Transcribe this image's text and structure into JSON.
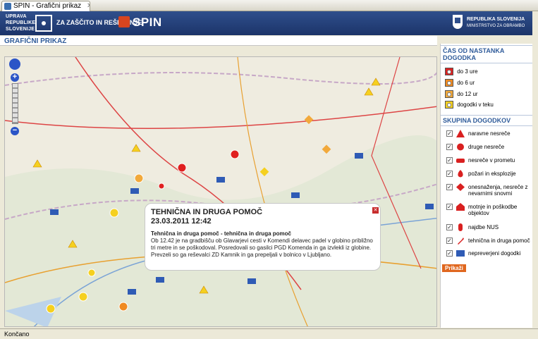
{
  "tab": {
    "title": "SPIN - Grafični prikaz"
  },
  "header": {
    "logo_lines": [
      "UPRAVA",
      "REPUBLIKE",
      "SLOVENIJE"
    ],
    "subtitle": "ZA ZAŠČITO IN REŠEVANJE",
    "app_name": "SPIN",
    "ministry_line1": "REPUBLIKA SLOVENIJA",
    "ministry_line2": "MINISTRSTVO ZA OBRAMBO"
  },
  "page_title": "GRAFIČNI PRIKAZ",
  "popup": {
    "title": "TEHNIČNA IN DRUGA POMOČ",
    "date": "23.03.2011 12:42",
    "subtitle": "Tehnična in druga pomoč - tehnična in druga pomoč",
    "body": "Ob 12.42 je na gradbišču ob Glavarjevi cesti v Komendi delavec padel v globino približno tri metre in se poškodoval. Posredovali so gasilci PGD Komenda in ga izvlekli iz globine. Prevzeli so ga reševalci ZD Kamnik in ga prepeljali v bolnico v Ljubljano."
  },
  "sidebar": {
    "time_heading": "ČAS OD NASTANKA DOGODKA",
    "time_items": [
      {
        "label": "do 3 ure",
        "color": "#e02020"
      },
      {
        "label": "do 6 ur",
        "color": "#f08a20"
      },
      {
        "label": "do 12 ur",
        "color": "#f2a93b"
      },
      {
        "label": "dogodki v teku",
        "color": "#f5d020"
      }
    ],
    "group_heading": "SKUPINA DOGODKOV",
    "group_items": [
      {
        "label": "naravne nesreče",
        "checked": true
      },
      {
        "label": "druge nesreče",
        "checked": true
      },
      {
        "label": "nesreče v prometu",
        "checked": true
      },
      {
        "label": "požari in eksplozije",
        "checked": true
      },
      {
        "label": "onesnaženja, nesreče z nevarnimi snovmi",
        "checked": true
      },
      {
        "label": "motnje in poškodbe objektov",
        "checked": true
      },
      {
        "label": "najdbe NUS",
        "checked": true
      },
      {
        "label": "tehnična in druga pomoč",
        "checked": true
      },
      {
        "label": "nepreverjeni dogodki",
        "checked": true
      }
    ],
    "show_button": "Prikaži"
  },
  "status": "Končano",
  "colors": {
    "header_bg": "#1c3469",
    "accent": "#2f5b9a",
    "button": "#e0671f"
  }
}
